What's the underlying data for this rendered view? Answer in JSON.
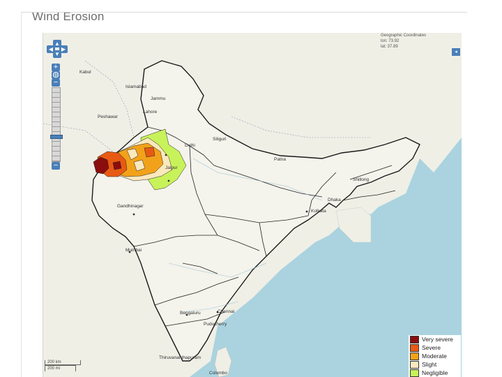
{
  "page": {
    "title": "Wind Erosion"
  },
  "coords": {
    "heading": "Geographic Coordinates",
    "lon": "lon: 73.92",
    "lat": "lat: 37.89"
  },
  "controls": {
    "zoom_in": "+",
    "zoom_out": "−",
    "world": "◍",
    "layer_toggle": "◂",
    "pan": {
      "up": "▲",
      "down": "▼",
      "left": "◀",
      "right": "▶"
    }
  },
  "legend": {
    "items": [
      {
        "label": "Very severe",
        "color": "#8b0d0d"
      },
      {
        "label": "Severe",
        "color": "#e85a13"
      },
      {
        "label": "Moderate",
        "color": "#f2a21a"
      },
      {
        "label": "Slight",
        "color": "#fbe8bd"
      },
      {
        "label": "Negligible",
        "color": "#c8f25a"
      }
    ]
  },
  "scale": {
    "km": "200 km",
    "mi": "200 mi"
  },
  "places": {
    "kabul": "Kabul",
    "islamabad": "Islamabad",
    "jammu": "Jammu",
    "lahore": "Lahore",
    "peshawar": "Peshawar",
    "delhi": "Delhi",
    "jaipur": "Jaipur",
    "gandhinagar": "Gandhinagar",
    "mumbai": "Mumbai",
    "bengaluru": "Bengaluru",
    "chennai": "Chennai",
    "puducherry": "Puducherry",
    "colombo": "Colombo",
    "thiruvananthapuram": "Thiruvananthapuram",
    "kolkata": "Kolkata",
    "patna": "Patna",
    "shillong": "Shillong",
    "siliguri": "Siliguri",
    "dhaka": "Dhaka"
  }
}
